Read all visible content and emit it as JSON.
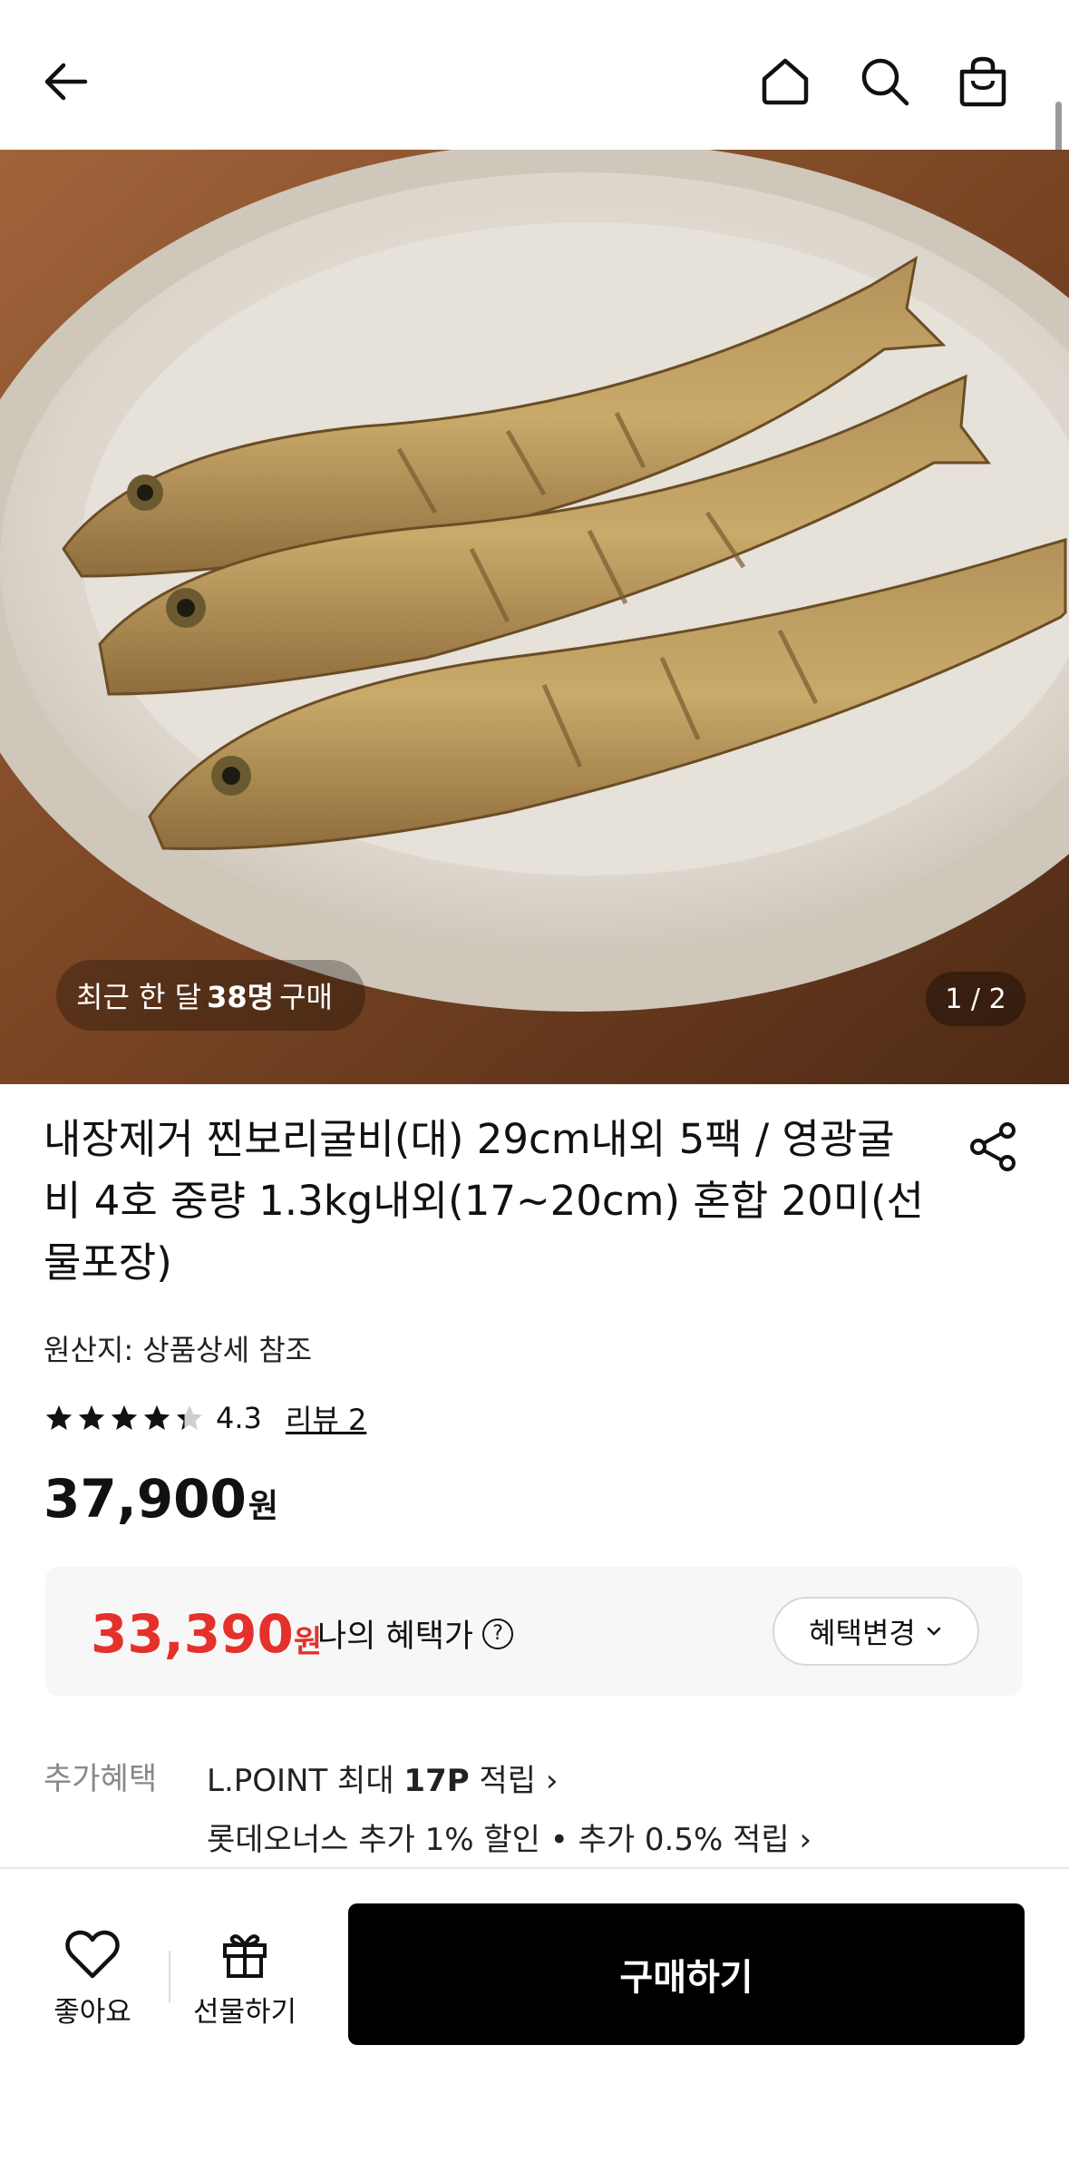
{
  "header": {
    "icons": [
      "back-arrow-icon",
      "home-icon",
      "search-icon",
      "shopping-bag-icon"
    ]
  },
  "hero": {
    "buyers_prefix": "최근 한 달",
    "buyers_count": "38명",
    "buyers_suffix": "구매",
    "pager": "1 / 2"
  },
  "product": {
    "title": "내장제거 찐보리굴비(대) 29cm내외 5팩 / 영광굴비 4호 중량 1.3kg내외(17~20cm) 혼합 20미(선물포장)",
    "origin": "원산지: 상품상세 참조",
    "rating": 4.3,
    "rating_text": "4.3",
    "review_link": "리뷰 2",
    "price": "37,900",
    "currency": "원"
  },
  "benefit": {
    "price": "33,390",
    "currency": "원",
    "label": "나의 혜택가",
    "help": "?",
    "change_button": "혜택변경"
  },
  "extra": {
    "label": "추가혜택",
    "line1_prefix": "L.POINT 최대 ",
    "line1_bold": "17P",
    "line1_suffix": " 적립 ›",
    "line2": "롯데오너스 추가 1% 할인 • 추가 0.5% 적립 ›"
  },
  "bottom": {
    "like": "좋아요",
    "gift": "선물하기",
    "buy": "구매하기"
  },
  "colors": {
    "accent_red": "#e4312b",
    "buy_button": "#000000"
  }
}
